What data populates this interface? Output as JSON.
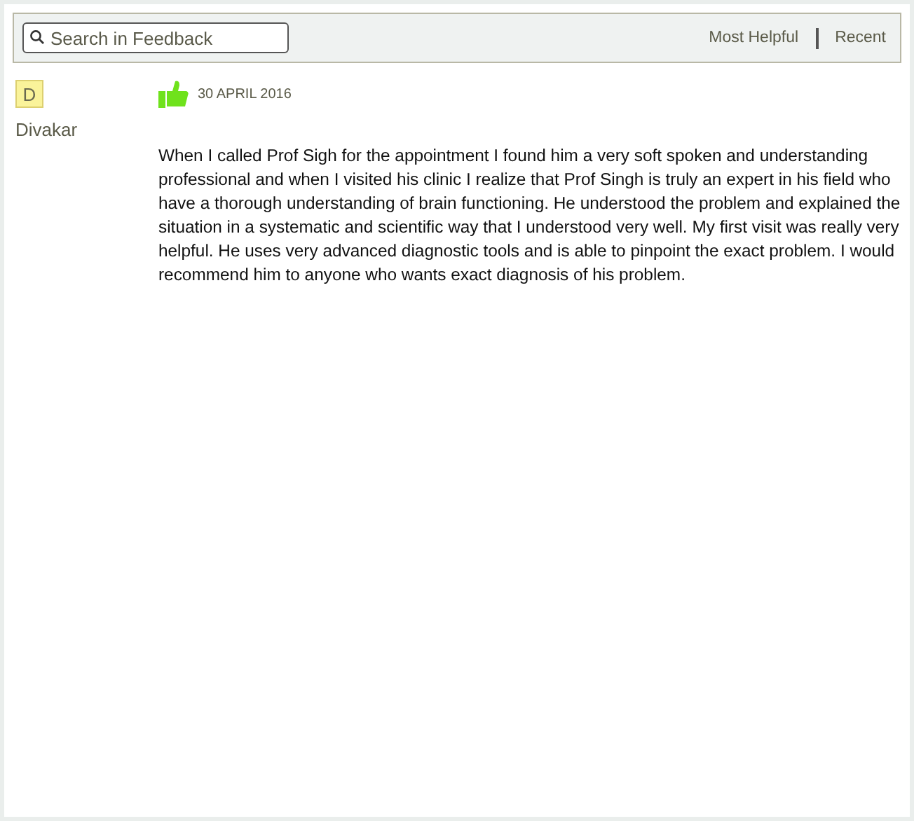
{
  "search": {
    "placeholder": "Search in Feedback"
  },
  "sort_options": [
    "Most Helpful",
    "Recent"
  ],
  "reviews": [
    {
      "initial": "D",
      "name": "Divakar",
      "date": "30 APRIL 2016",
      "text": "When I called Prof Sigh for the appointment I found him a very soft spoken and understanding professional and when I visited his clinic I realize that Prof Singh is truly an expert in his field who have a thorough understanding of brain functioning. He understood the problem and explained the situation in a systematic and scientific way that I understood very well. My first visit was really very helpful. He uses very advanced diagnostic tools and is able to pinpoint the exact problem. I would recommend him to anyone who wants exact diagnosis of his problem."
    }
  ]
}
